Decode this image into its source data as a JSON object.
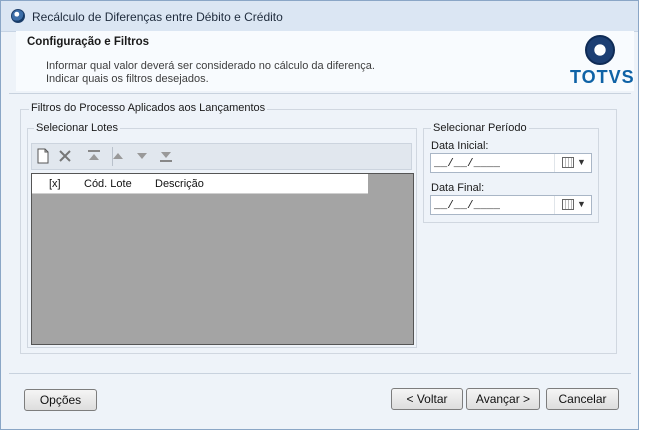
{
  "window": {
    "title": "Recálculo de Diferenças entre Débito e Crédito"
  },
  "header": {
    "title": "Configuração e Filtros",
    "line1": "Informar qual valor deverá ser considerado no cálculo da diferença.",
    "line2": "Indicar quais os filtros desejados.",
    "logo_text": "TOTVS"
  },
  "filters_group": {
    "label": "Filtros do Processo Aplicados aos Lançamentos"
  },
  "lots": {
    "label": "Selecionar Lotes",
    "toolbar": [
      "new-icon",
      "delete-icon",
      "move-top-icon",
      "move-up-icon",
      "move-down-icon",
      "move-bottom-icon"
    ],
    "columns": [
      "[x]",
      "Cód. Lote",
      "Descrição"
    ],
    "rows": []
  },
  "period": {
    "label": "Selecionar Período",
    "start_label": "Data Inicial:",
    "start_value": "__/__/____",
    "end_label": "Data Final:",
    "end_value": "__/__/____"
  },
  "buttons": {
    "options": "Opções",
    "back": "< Voltar",
    "next": "Avançar >",
    "cancel": "Cancelar"
  }
}
